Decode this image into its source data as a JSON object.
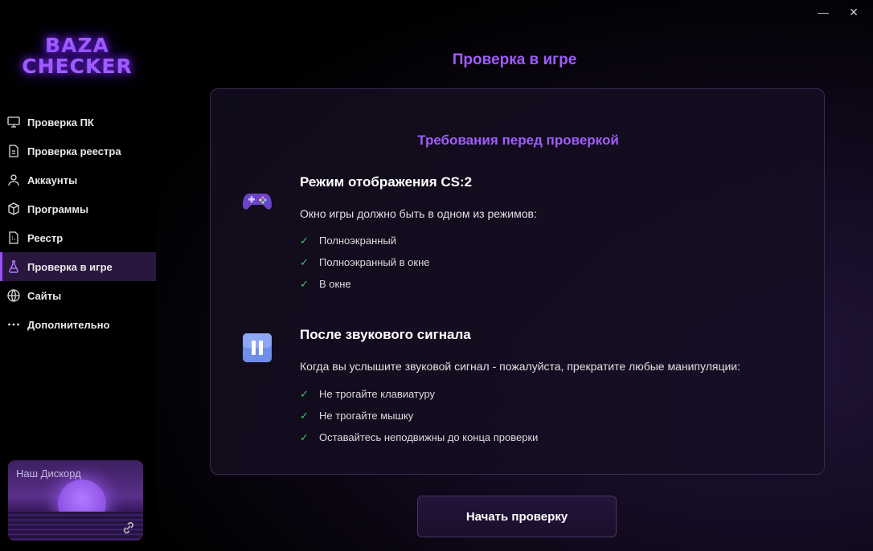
{
  "app": {
    "logo_line1": "BAZA",
    "logo_line2": "CHECKER"
  },
  "window": {
    "minimize_glyph": "—",
    "close_glyph": "✕"
  },
  "sidebar": {
    "items": [
      {
        "label": "Проверка ПК",
        "icon": "monitor-icon"
      },
      {
        "label": "Проверка реестра",
        "icon": "document-icon"
      },
      {
        "label": "Аккаунты",
        "icon": "user-icon"
      },
      {
        "label": "Программы",
        "icon": "box-icon"
      },
      {
        "label": "Реестр",
        "icon": "registry-icon"
      },
      {
        "label": "Проверка в игре",
        "icon": "flask-icon",
        "active": true
      },
      {
        "label": "Сайты",
        "icon": "globe-icon"
      },
      {
        "label": "Дополнительно",
        "icon": "more-icon"
      }
    ],
    "discord": {
      "label": "Наш Дискорд",
      "icon": "link-icon"
    }
  },
  "main": {
    "title": "Проверка в игре",
    "card": {
      "title": "Требования перед проверкой",
      "sections": [
        {
          "icon": "gamepad-icon",
          "title": "Режим отображения CS:2",
          "desc": "Окно игры должно быть в одном из режимов:",
          "items": [
            "Полноэкранный",
            "Полноэкранный в окне",
            "В окне"
          ]
        },
        {
          "icon": "pause-icon",
          "title": "После звукового сигнала",
          "desc": "Когда вы услышите звуковой сигнал - пожалуйста, прекратите любые манипуляции:",
          "items": [
            "Не трогайте клавиатуру",
            "Не трогайте мышку",
            "Оставайтесь неподвижны до конца проверки"
          ]
        }
      ]
    },
    "start_button": "Начать проверку"
  },
  "colors": {
    "accent": "#a05cff",
    "check": "#4fc46a",
    "active_bg": "#2a1740"
  }
}
